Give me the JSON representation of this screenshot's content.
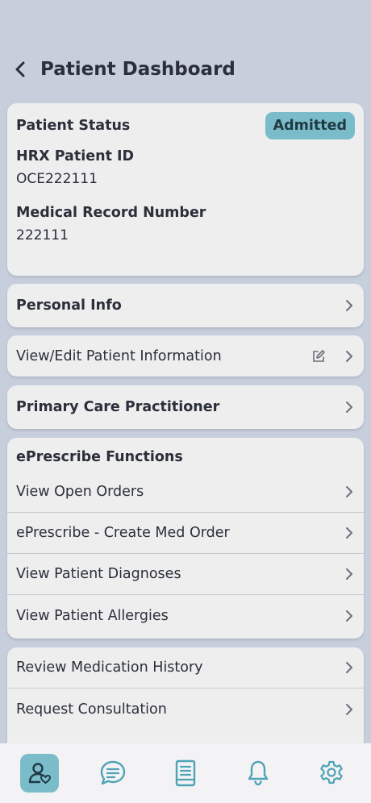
{
  "header": {
    "title": "Patient Dashboard"
  },
  "status": {
    "label": "Patient Status",
    "badge": "Admitted",
    "hrx_label": "HRX Patient ID",
    "hrx_value": "OCE222111",
    "mrn_label": "Medical Record Number",
    "mrn_value": "222111"
  },
  "personal_info": {
    "label": "Personal Info"
  },
  "view_edit": {
    "label": "View/Edit Patient Information"
  },
  "pcp": {
    "label": "Primary Care Practitioner"
  },
  "eprescribe": {
    "title": "ePrescribe Functions",
    "items": [
      {
        "label": "View Open Orders"
      },
      {
        "label": "ePrescribe - Create Med Order"
      },
      {
        "label": "View Patient Diagnoses"
      },
      {
        "label": "View Patient Allergies"
      }
    ]
  },
  "other": {
    "items": [
      {
        "label": "Review Medication History"
      },
      {
        "label": "Request Consultation"
      }
    ]
  },
  "nav": {
    "items": [
      {
        "icon": "patient-icon",
        "active": true
      },
      {
        "icon": "chat-icon",
        "active": false
      },
      {
        "icon": "document-icon",
        "active": false
      },
      {
        "icon": "bell-icon",
        "active": false
      },
      {
        "icon": "gear-icon",
        "active": false
      }
    ]
  },
  "colors": {
    "accent": "#7bbcca",
    "background": "#c7cfdd",
    "card": "#eeeeef"
  }
}
